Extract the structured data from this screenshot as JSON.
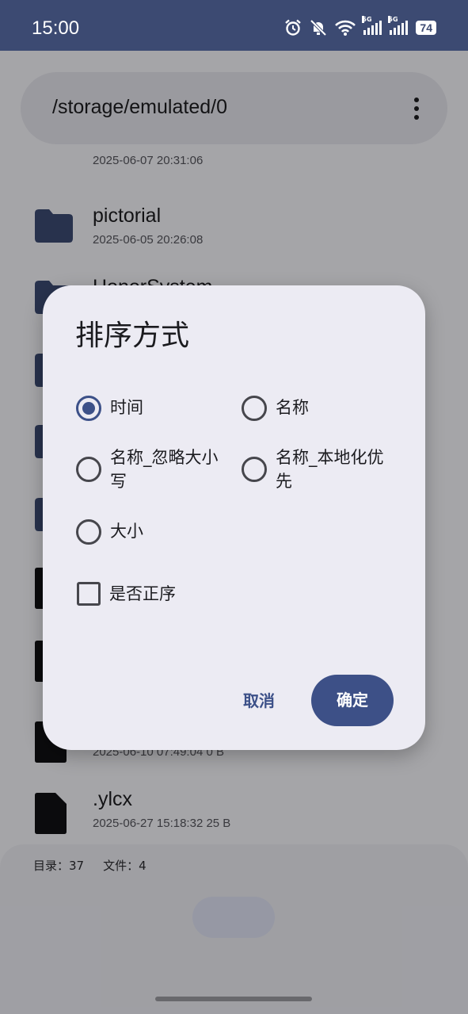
{
  "status_bar": {
    "time": "15:00",
    "battery": "74",
    "net1": "5G",
    "net2": "5G"
  },
  "path_bar": {
    "path": "/storage/emulated/0"
  },
  "files": [
    {
      "name": "",
      "meta": "2025-06-07 20:31:06"
    },
    {
      "name": "pictorial",
      "meta": "2025-06-05 20:26:08"
    },
    {
      "name": "HonorSystem",
      "meta": ""
    },
    {
      "name": "",
      "meta": "2025-06-10 07:49:04    0 B"
    },
    {
      "name": ".ylcx",
      "meta": "2025-06-27 15:18:32    25 B"
    }
  ],
  "footer": {
    "dirs": "目录：37",
    "files": "文件：4"
  },
  "dialog": {
    "title": "排序方式",
    "options": [
      {
        "label": "时间",
        "checked": true
      },
      {
        "label": "名称",
        "checked": false
      },
      {
        "label": "名称_忽略大小写",
        "checked": false
      },
      {
        "label": "名称_本地化优先",
        "checked": false
      },
      {
        "label": "大小",
        "checked": false
      }
    ],
    "checkbox": {
      "label": "是否正序",
      "checked": false
    },
    "cancel": "取消",
    "confirm": "确定"
  },
  "colors": {
    "accent": "#3c5088",
    "status_bar": "#3c4a72",
    "folder": "#3c4a72"
  }
}
